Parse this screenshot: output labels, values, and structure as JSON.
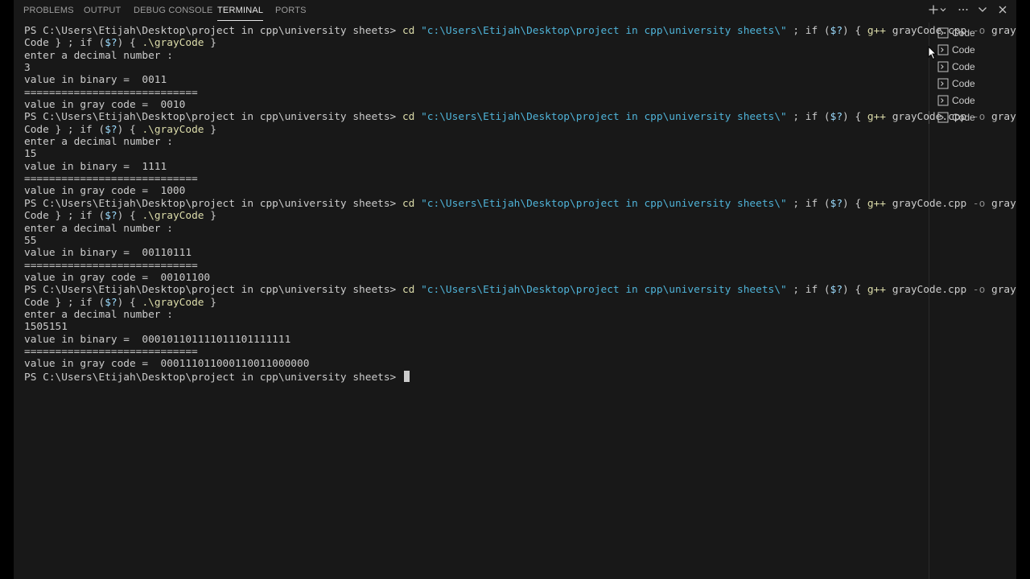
{
  "panel_tabs": [
    {
      "label": "PROBLEMS",
      "active": false
    },
    {
      "label": "OUTPUT",
      "active": false
    },
    {
      "label": "DEBUG CONSOLE",
      "active": false
    },
    {
      "label": "TERMINAL",
      "active": true
    },
    {
      "label": "PORTS",
      "active": false
    }
  ],
  "toolbar_icons": [
    "plus-icon",
    "chevron-down-icon",
    "ellipsis-icon",
    "chevron-down-icon",
    "close-icon"
  ],
  "terminal_lines": [
    [
      {
        "t": "PS C:\\Users\\Etijah\\Desktop\\project in cpp\\university sheets> ",
        "c": "default"
      },
      {
        "t": "cd ",
        "c": "cmd"
      },
      {
        "t": "\"c:\\Users\\Etijah\\Desktop\\project in cpp\\university sheets\\\"",
        "c": "str"
      },
      {
        "t": " ; ",
        "c": "op"
      },
      {
        "t": "if ",
        "c": "default"
      },
      {
        "t": "(",
        "c": "op"
      },
      {
        "t": "$?",
        "c": "var"
      },
      {
        "t": ") { ",
        "c": "op"
      },
      {
        "t": "g++ ",
        "c": "cmd"
      },
      {
        "t": "grayCode.cpp ",
        "c": "default"
      },
      {
        "t": "-o ",
        "c": "flag"
      },
      {
        "t": "gray",
        "c": "default"
      }
    ],
    [
      {
        "t": "Code } ; ",
        "c": "default"
      },
      {
        "t": "if ",
        "c": "default"
      },
      {
        "t": "(",
        "c": "op"
      },
      {
        "t": "$?",
        "c": "var"
      },
      {
        "t": ") { ",
        "c": "op"
      },
      {
        "t": ".\\grayCode",
        "c": "cmd"
      },
      {
        "t": " }",
        "c": "op"
      }
    ],
    [
      {
        "t": "enter a decimal number :",
        "c": "default"
      }
    ],
    [
      {
        "t": "3",
        "c": "default"
      }
    ],
    [
      {
        "t": "value in binary =  0011",
        "c": "default"
      }
    ],
    [
      {
        "t": "============================",
        "c": "default"
      }
    ],
    [
      {
        "t": "value in gray code =  0010",
        "c": "default"
      }
    ],
    [
      {
        "t": "PS C:\\Users\\Etijah\\Desktop\\project in cpp\\university sheets> ",
        "c": "default"
      },
      {
        "t": "cd ",
        "c": "cmd"
      },
      {
        "t": "\"c:\\Users\\Etijah\\Desktop\\project in cpp\\university sheets\\\"",
        "c": "str"
      },
      {
        "t": " ; ",
        "c": "op"
      },
      {
        "t": "if ",
        "c": "default"
      },
      {
        "t": "(",
        "c": "op"
      },
      {
        "t": "$?",
        "c": "var"
      },
      {
        "t": ") { ",
        "c": "op"
      },
      {
        "t": "g++ ",
        "c": "cmd"
      },
      {
        "t": "grayCode.cpp ",
        "c": "default"
      },
      {
        "t": "-o ",
        "c": "flag"
      },
      {
        "t": "gray",
        "c": "default"
      }
    ],
    [
      {
        "t": "Code } ; ",
        "c": "default"
      },
      {
        "t": "if ",
        "c": "default"
      },
      {
        "t": "(",
        "c": "op"
      },
      {
        "t": "$?",
        "c": "var"
      },
      {
        "t": ") { ",
        "c": "op"
      },
      {
        "t": ".\\grayCode",
        "c": "cmd"
      },
      {
        "t": " }",
        "c": "op"
      }
    ],
    [
      {
        "t": "enter a decimal number :",
        "c": "default"
      }
    ],
    [
      {
        "t": "15",
        "c": "default"
      }
    ],
    [
      {
        "t": "value in binary =  1111",
        "c": "default"
      }
    ],
    [
      {
        "t": "============================",
        "c": "default"
      }
    ],
    [
      {
        "t": "value in gray code =  1000",
        "c": "default"
      }
    ],
    [
      {
        "t": "PS C:\\Users\\Etijah\\Desktop\\project in cpp\\university sheets> ",
        "c": "default"
      },
      {
        "t": "cd ",
        "c": "cmd"
      },
      {
        "t": "\"c:\\Users\\Etijah\\Desktop\\project in cpp\\university sheets\\\"",
        "c": "str"
      },
      {
        "t": " ; ",
        "c": "op"
      },
      {
        "t": "if ",
        "c": "default"
      },
      {
        "t": "(",
        "c": "op"
      },
      {
        "t": "$?",
        "c": "var"
      },
      {
        "t": ") { ",
        "c": "op"
      },
      {
        "t": "g++ ",
        "c": "cmd"
      },
      {
        "t": "grayCode.cpp ",
        "c": "default"
      },
      {
        "t": "-o ",
        "c": "flag"
      },
      {
        "t": "gray",
        "c": "default"
      }
    ],
    [
      {
        "t": "Code } ; ",
        "c": "default"
      },
      {
        "t": "if ",
        "c": "default"
      },
      {
        "t": "(",
        "c": "op"
      },
      {
        "t": "$?",
        "c": "var"
      },
      {
        "t": ") { ",
        "c": "op"
      },
      {
        "t": ".\\grayCode",
        "c": "cmd"
      },
      {
        "t": " }",
        "c": "op"
      }
    ],
    [
      {
        "t": "enter a decimal number :",
        "c": "default"
      }
    ],
    [
      {
        "t": "55",
        "c": "default"
      }
    ],
    [
      {
        "t": "value in binary =  00110111",
        "c": "default"
      }
    ],
    [
      {
        "t": "============================",
        "c": "default"
      }
    ],
    [
      {
        "t": "value in gray code =  00101100",
        "c": "default"
      }
    ],
    [
      {
        "t": "PS C:\\Users\\Etijah\\Desktop\\project in cpp\\university sheets> ",
        "c": "default"
      },
      {
        "t": "cd ",
        "c": "cmd"
      },
      {
        "t": "\"c:\\Users\\Etijah\\Desktop\\project in cpp\\university sheets\\\"",
        "c": "str"
      },
      {
        "t": " ; ",
        "c": "op"
      },
      {
        "t": "if ",
        "c": "default"
      },
      {
        "t": "(",
        "c": "op"
      },
      {
        "t": "$?",
        "c": "var"
      },
      {
        "t": ") { ",
        "c": "op"
      },
      {
        "t": "g++ ",
        "c": "cmd"
      },
      {
        "t": "grayCode.cpp ",
        "c": "default"
      },
      {
        "t": "-o ",
        "c": "flag"
      },
      {
        "t": "gray",
        "c": "default"
      }
    ],
    [
      {
        "t": "Code } ; ",
        "c": "default"
      },
      {
        "t": "if ",
        "c": "default"
      },
      {
        "t": "(",
        "c": "op"
      },
      {
        "t": "$?",
        "c": "var"
      },
      {
        "t": ") { ",
        "c": "op"
      },
      {
        "t": ".\\grayCode",
        "c": "cmd"
      },
      {
        "t": " }",
        "c": "op"
      }
    ],
    [
      {
        "t": "enter a decimal number :",
        "c": "default"
      }
    ],
    [
      {
        "t": "1505151",
        "c": "default"
      }
    ],
    [
      {
        "t": "value in binary =  000101101111011101111111",
        "c": "default"
      }
    ],
    [
      {
        "t": "============================",
        "c": "default"
      }
    ],
    [
      {
        "t": "value in gray code =  000111011000110011000000",
        "c": "default"
      }
    ],
    [
      {
        "t": "PS C:\\Users\\Etijah\\Desktop\\project in cpp\\university sheets> ",
        "c": "default"
      }
    ]
  ],
  "terminal_list": [
    {
      "label": "Code",
      "active": false
    },
    {
      "label": "Code",
      "active": false
    },
    {
      "label": "Code",
      "active": false
    },
    {
      "label": "Code",
      "active": false
    },
    {
      "label": "Code",
      "active": false
    },
    {
      "label": "Code",
      "active": true
    }
  ],
  "colors": {
    "background": "#181818",
    "text": "#cccccc",
    "command": "#dcdcaa",
    "string": "#4fb3d8",
    "flag": "#8a8a8a",
    "variable": "#9cdcfe"
  }
}
